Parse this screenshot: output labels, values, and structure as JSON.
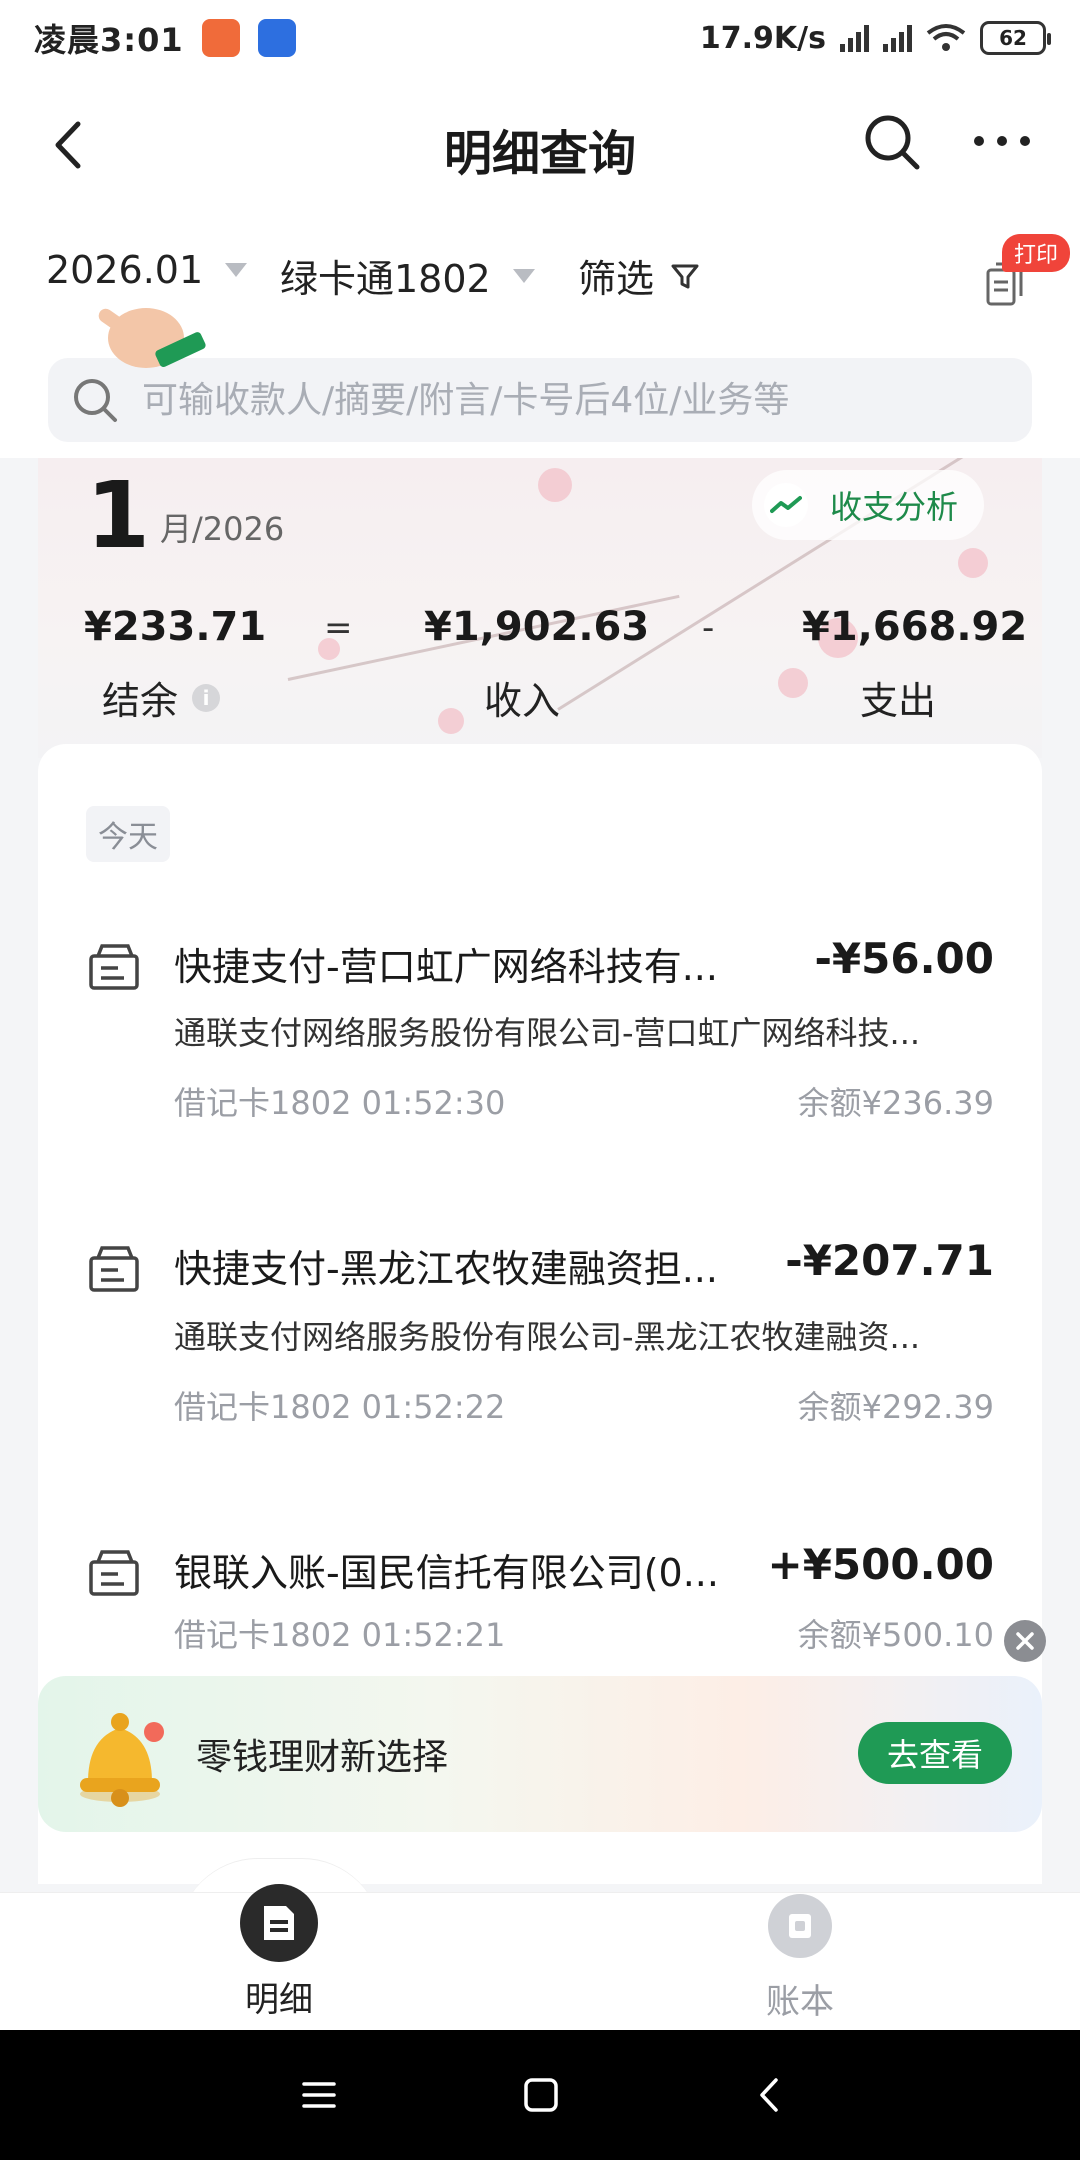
{
  "status_bar": {
    "time": "凌晨3:01",
    "network_speed": "17.9K/s",
    "battery": "62"
  },
  "header": {
    "title": "明细查询"
  },
  "filters": {
    "month": "2026.01",
    "card": "绿卡通1802",
    "filter_label": "筛选",
    "print_badge": "打印"
  },
  "search": {
    "placeholder": "可输收款人/摘要/附言/卡号后4位/业务等"
  },
  "summary": {
    "month": "1",
    "month_suffix": "月/2026",
    "analysis_label": "收支分析",
    "balance": "¥233.71",
    "equals": "=",
    "income": "¥1,902.63",
    "minus": "-",
    "expense": "¥1,668.92",
    "balance_label": "结余",
    "income_label": "收入",
    "expense_label": "支出"
  },
  "transactions": {
    "day_label": "今天",
    "items": [
      {
        "title": "快捷支付-营口虹广网络科技有...",
        "amount": "-¥56.00",
        "desc": "通联支付网络服务股份有限公司-营口虹广网络科技...",
        "meta": "借记卡1802 01:52:30",
        "balance": "余额¥236.39"
      },
      {
        "title": "快捷支付-黑龙江农牧建融资担...",
        "amount": "-¥207.71",
        "desc": "通联支付网络服务股份有限公司-黑龙江农牧建融资...",
        "meta": "借记卡1802 01:52:22",
        "balance": "余额¥292.39"
      },
      {
        "title": "银联入账-国民信托有限公司(0...",
        "amount": "+¥500.00",
        "meta": "借记卡1802 01:52:21",
        "balance": "余额¥500.10"
      }
    ]
  },
  "promo": {
    "text": "零钱理财新选择",
    "button": "去查看"
  },
  "bottom_nav": {
    "detail": "明细",
    "ledger": "账本"
  },
  "colors": {
    "accent_green": "#1f9a55",
    "badge_red": "#f0443a"
  }
}
